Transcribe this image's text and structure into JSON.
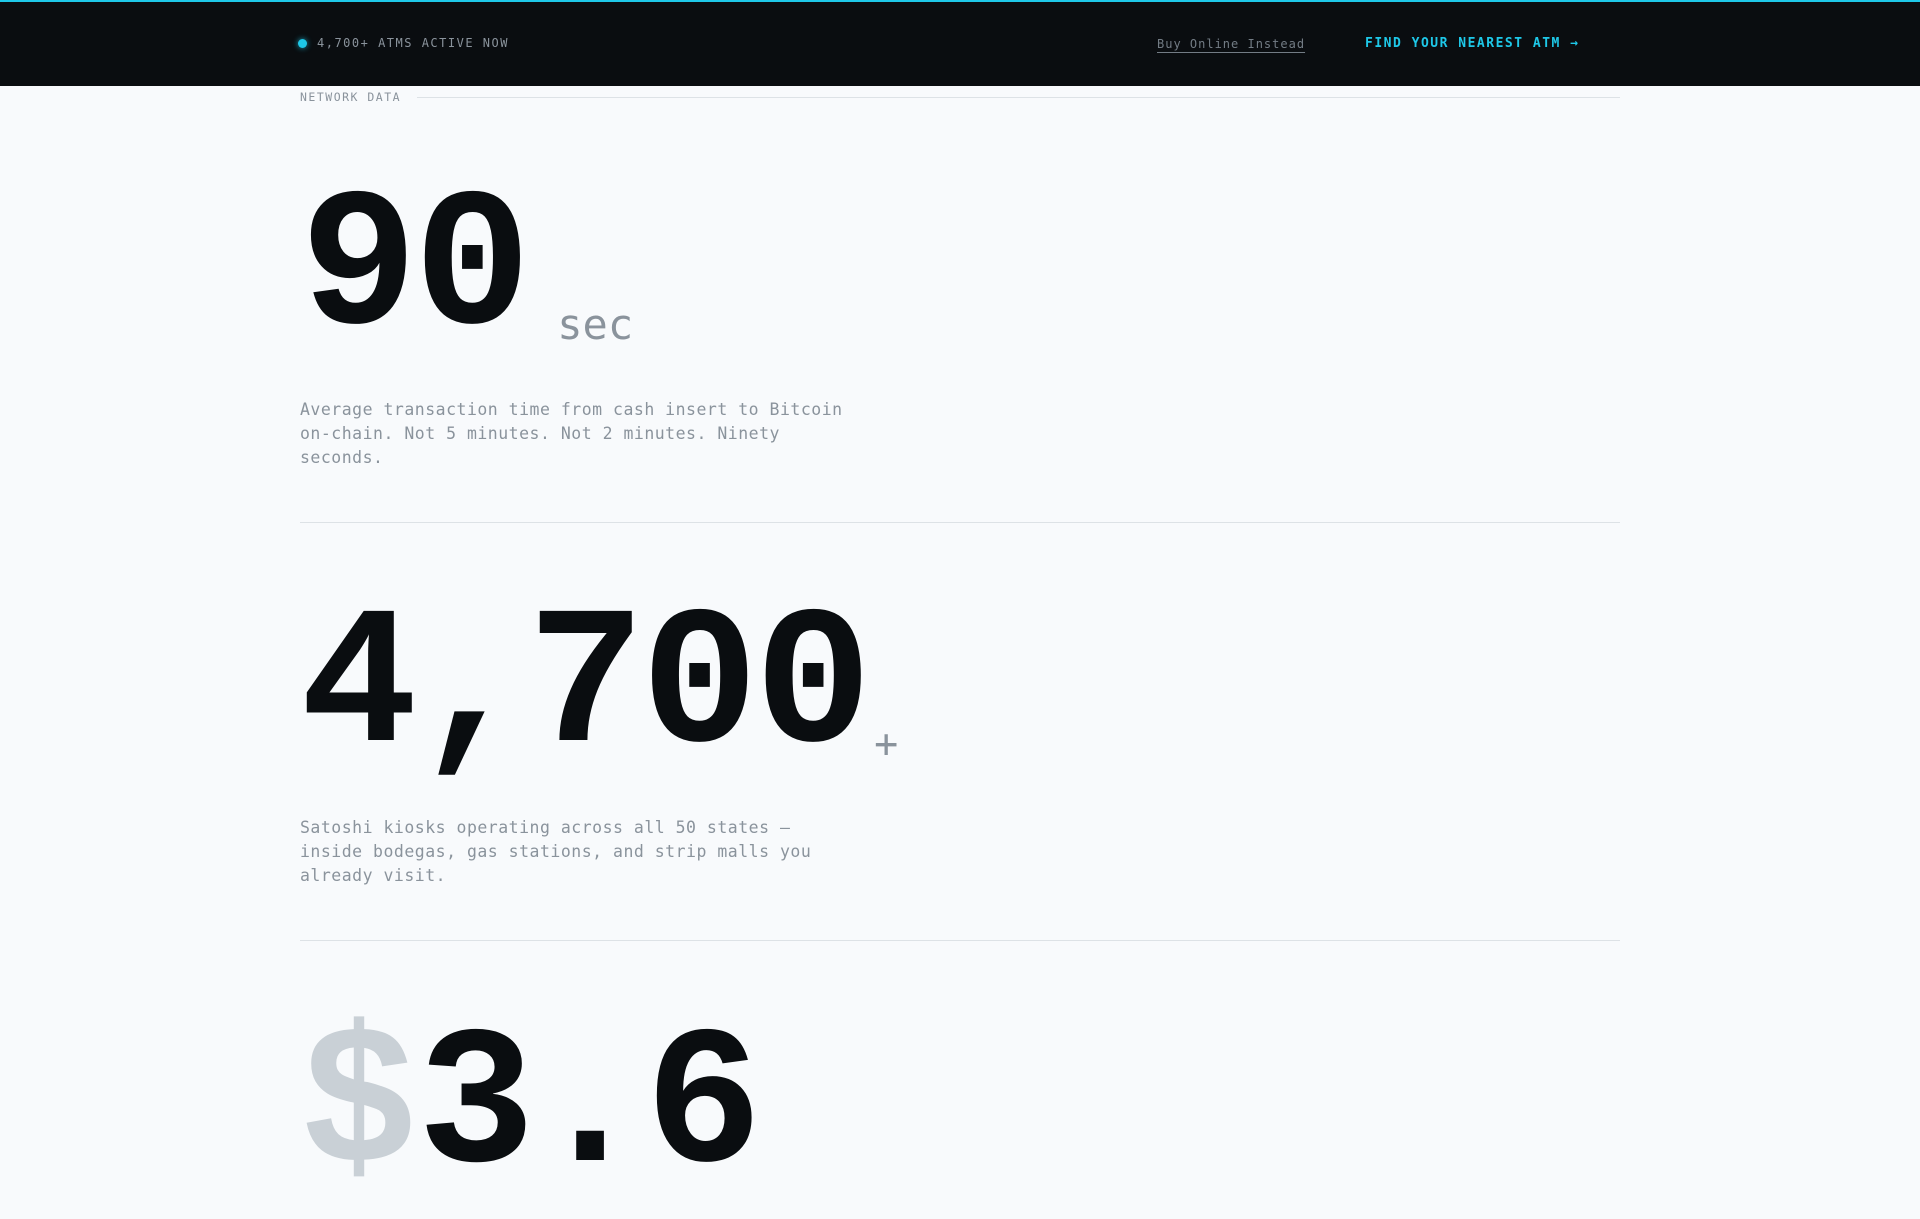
{
  "header": {
    "status_text": "4,700+ ATMS ACTIVE NOW",
    "buy_online_label": "Buy Online Instead",
    "find_atm_label": "FIND YOUR NEAREST ATM →"
  },
  "section": {
    "label": "NETWORK DATA"
  },
  "stats": [
    {
      "value": "90",
      "unit": "sec",
      "description": "Average transaction time from cash insert to Bitcoin on-chain. Not 5 minutes. Not 2 minutes. Ninety seconds."
    },
    {
      "value": "4,700",
      "unit": "+",
      "description": "Satoshi kiosks operating across all 50 states — inside bodegas, gas stations, and strip malls you already visit."
    },
    {
      "prefix": "$",
      "value": "3.6"
    }
  ],
  "colors": {
    "accent": "#1ec8e8",
    "dark": "#0a0d10",
    "muted": "#8a939c",
    "background": "#f8fafc"
  }
}
